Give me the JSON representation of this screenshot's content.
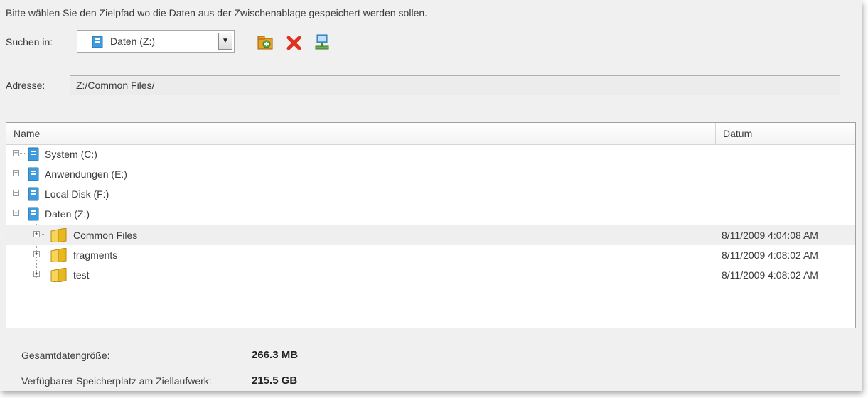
{
  "instruction": "Bitte wählen Sie den Zielpfad wo die Daten aus der Zwischenablage gespeichert werden sollen.",
  "search": {
    "label": "Suchen in:",
    "selected": "Daten (Z:)"
  },
  "toolbar": {
    "icons": [
      "new-folder-icon",
      "delete-icon",
      "network-drive-icon"
    ]
  },
  "address": {
    "label": "Adresse:",
    "value": "Z:/Common Files/"
  },
  "list": {
    "columns": {
      "name": "Name",
      "date": "Datum"
    },
    "drives": [
      {
        "label": "System (C:)",
        "expander": "+"
      },
      {
        "label": "Anwendungen (E:)",
        "expander": "+"
      },
      {
        "label": "Local Disk (F:)",
        "expander": "+"
      },
      {
        "label": "Daten (Z:)",
        "expander": "−"
      }
    ],
    "folders": [
      {
        "label": "Common Files",
        "date": "8/11/2009 4:04:08 AM",
        "selected": true
      },
      {
        "label": "fragments",
        "date": "8/11/2009 4:08:02 AM",
        "selected": false
      },
      {
        "label": "test",
        "date": "8/11/2009 4:08:02 AM",
        "selected": false
      }
    ]
  },
  "summary": {
    "total_label": "Gesamtdatengröße:",
    "total_value": "266.3 MB",
    "free_label": "Verfügbarer Speicherplatz am Ziellaufwerk:",
    "free_value": "215.5 GB"
  },
  "colors": {
    "drive_blue": "#3f9be0",
    "folder_yellow": "#e8b820",
    "delete_red": "#e03020"
  }
}
